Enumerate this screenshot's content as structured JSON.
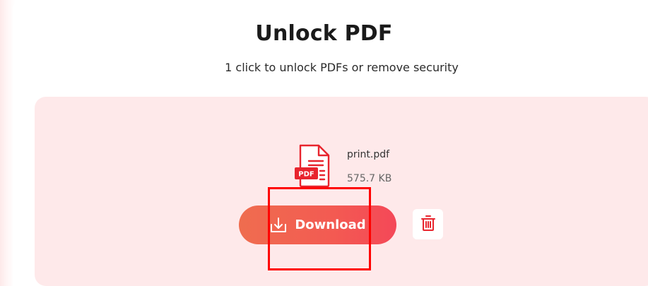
{
  "header": {
    "title": "Unlock PDF",
    "subtitle": "1 click to unlock PDFs or remove security"
  },
  "file": {
    "name": "print.pdf",
    "size": "575.7 KB",
    "icon": "pdf-file-icon",
    "badge": "PDF"
  },
  "actions": {
    "download_label": "Download",
    "download_icon": "download-icon",
    "delete_icon": "trash-icon"
  },
  "colors": {
    "accent": "#f44858",
    "button_start": "#ef6d4f",
    "dropzone_bg": "#fee9ea",
    "highlight": "#ff0000"
  }
}
